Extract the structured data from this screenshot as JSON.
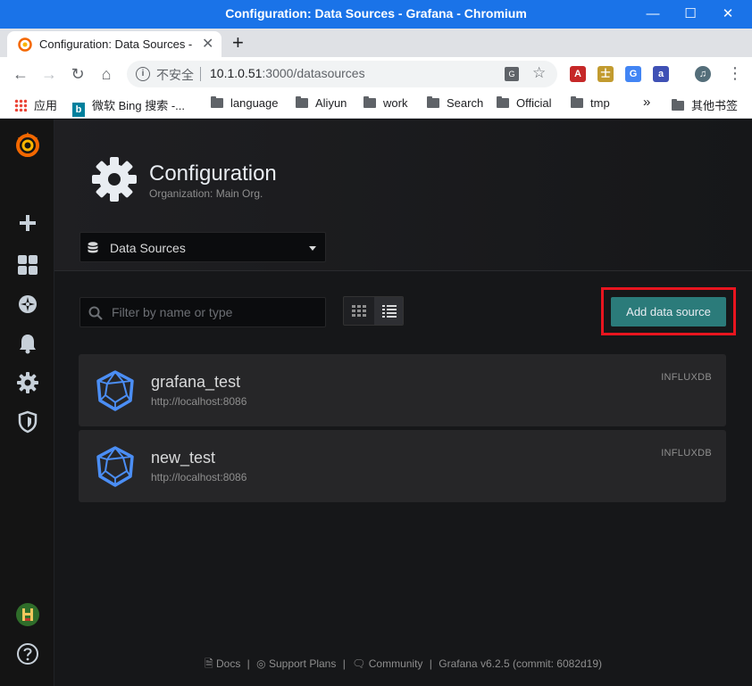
{
  "window": {
    "title": "Configuration: Data Sources - Grafana - Chromium"
  },
  "tab": {
    "title": "Configuration: Data Sources -"
  },
  "omnibox": {
    "insecure_label": "不安全",
    "url_host": "10.1.0.51",
    "url_rest": ":3000/datasources"
  },
  "bookmarks": {
    "apps": "应用",
    "bing": "微软 Bing 搜索 -...",
    "items": [
      "language",
      "Aliyun",
      "work",
      "Search",
      "Official",
      "tmp"
    ],
    "overflow": "»",
    "other": "其他书签"
  },
  "header": {
    "title": "Configuration",
    "subtitle": "Organization: Main Org.",
    "nav_selected": "Data Sources"
  },
  "toolbar": {
    "filter_placeholder": "Filter by name or type",
    "add_button": "Add data source"
  },
  "datasources": [
    {
      "name": "grafana_test",
      "url": "http://localhost:8086",
      "type": "INFLUXDB"
    },
    {
      "name": "new_test",
      "url": "http://localhost:8086",
      "type": "INFLUXDB"
    }
  ],
  "footer": {
    "docs": "Docs",
    "support": "Support Plans",
    "community": "Community",
    "version": "Grafana v6.2.5 (commit: 6082d19)"
  },
  "colors": {
    "accent": "#2b7b7a",
    "highlight": "#e8151f",
    "influx_blue": "#4b8ef5",
    "grafana_orange": "#f46800"
  }
}
